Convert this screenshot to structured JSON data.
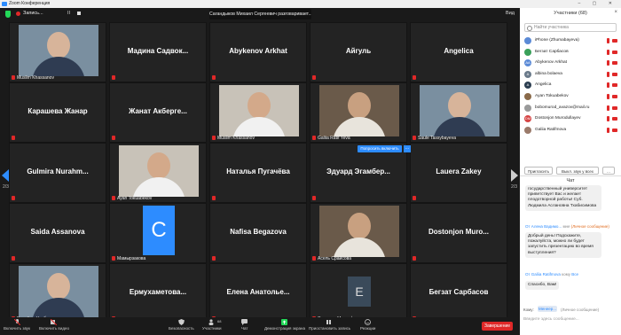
{
  "window": {
    "title": "Zoom Конференция"
  },
  "topbar": {
    "recording_label": "Запись...",
    "pause_label": "II",
    "speaker": "Сагандыков Михаил Сергеевич разговаривает...",
    "view_label": "Вид"
  },
  "tiles": [
    {
      "name": "",
      "label": "Muslim Khassanov",
      "type": "photo"
    },
    {
      "name": "Мадина Садвок...",
      "label": "",
      "type": "name"
    },
    {
      "name": "Abykenov Arkhat",
      "label": "",
      "type": "name"
    },
    {
      "name": "Айгуль",
      "label": "",
      "type": "name"
    },
    {
      "name": "Angelica",
      "label": "",
      "type": "name"
    },
    {
      "name": "Карашева Жанар",
      "label": "",
      "type": "name"
    },
    {
      "name": "Жанат Акберге...",
      "label": "",
      "type": "name"
    },
    {
      "name": "",
      "label": "Muslim Khassanov",
      "type": "photo"
    },
    {
      "name": "",
      "label": "Galiia Ratif Yeva",
      "type": "photo"
    },
    {
      "name": "",
      "label": "Saule Tassybayeva",
      "type": "photo"
    },
    {
      "name": "Gulmira Nurahm...",
      "label": "",
      "type": "name"
    },
    {
      "name": "",
      "label": "Ayan Tokuabekov",
      "type": "photo"
    },
    {
      "name": "Наталья Пугачёва",
      "label": "",
      "type": "name"
    },
    {
      "name": "Эдуард Эгамбер...",
      "label": "",
      "type": "name"
    },
    {
      "name": "Lauera Zakey",
      "label": "",
      "type": "name"
    },
    {
      "name": "Saida Assanova",
      "label": "",
      "type": "name"
    },
    {
      "name": "",
      "label": "Мамырзакова",
      "type": "avatar",
      "letter": "C"
    },
    {
      "name": "Nafisa Begazova",
      "label": "",
      "type": "name"
    },
    {
      "name": "",
      "label": "Асель Срайсова",
      "type": "photo"
    },
    {
      "name": "Dostonjon Muro...",
      "label": "",
      "type": "name"
    },
    {
      "name": "",
      "label": "Ерсайын Утебаев...",
      "type": "photo"
    },
    {
      "name": "Ермухаметова...",
      "label": "",
      "type": "name"
    },
    {
      "name": "Елена Анатолье...",
      "label": "",
      "type": "name"
    },
    {
      "name": "",
      "label": "Эльмира Мустафаева",
      "type": "avatar",
      "letter": "E"
    },
    {
      "name": "Бегзат Сарбасов",
      "label": "",
      "type": "name"
    }
  ],
  "tooltip": {
    "label": "Попросить включить",
    "more": "..."
  },
  "pagination": {
    "left": "2/3",
    "right": "2/3"
  },
  "toolbar": {
    "mic": "Включить звук",
    "video": "Включить видео",
    "security": "Безопасность",
    "participants": "Участники",
    "participants_count": "68",
    "chat": "Чат",
    "share": "Демонстрация экрана",
    "record": "Приостановить запись",
    "reactions": "Реакции",
    "end": "Завершение"
  },
  "panel": {
    "title": "Участники (68)",
    "search_placeholder": "Найти участника",
    "participants": [
      {
        "name": "iPhone (Zhumabayeva)",
        "initials": "",
        "color": "#5b8ad6"
      },
      {
        "name": "Бегзат Сарбасов",
        "initials": "",
        "color": "#3aa05a"
      },
      {
        "name": "Abykenov Arkhat",
        "initials": "AA",
        "color": "#5b8ad6"
      },
      {
        "name": "albina bolaeva",
        "initials": "A",
        "color": "#6a7a8a"
      },
      {
        "name": "Angelica",
        "initials": "A",
        "color": "#2c3e50"
      },
      {
        "name": "Ayan Tokuabekov",
        "initials": "",
        "color": "#8a6a4a"
      },
      {
        "name": "bobomurod_avazov@mail.ru",
        "initials": "",
        "color": "#9a9a9a"
      },
      {
        "name": "Dostonjon Murodullayev",
        "initials": "DM",
        "color": "#d64545"
      },
      {
        "name": "Galiia Ratifmova",
        "initials": "",
        "color": "#9a7a6a"
      }
    ],
    "invite_label": "Пригласить",
    "mute_all_label": "Выкл. звук у всех",
    "more_label": "..."
  },
  "chat": {
    "title": "Чат",
    "messages": [
      {
        "text": "государственный университет приветствует Вас и желает плодотворной работы! Суб. Людмила Аслановна Тхабисимова"
      },
      {
        "text": "Добрый день! Подскажите, пожалуйста, можно ли будет запустить презентацию во время выступления?"
      },
      {
        "text": "Спасибо, Вам!"
      }
    ],
    "meta1": {
      "from": "От Алена Вадимо...",
      "to": "мне",
      "private": "(Личное сообщение)"
    },
    "meta2": {
      "from": "От Galiia Ratifmova",
      "to": "кому",
      "everyone": "Все"
    },
    "to_label": "Кому:",
    "to_select": "Менеер...",
    "private_label": "(Личное сообщение)",
    "input_placeholder": "Введите здесь сообщение..."
  }
}
